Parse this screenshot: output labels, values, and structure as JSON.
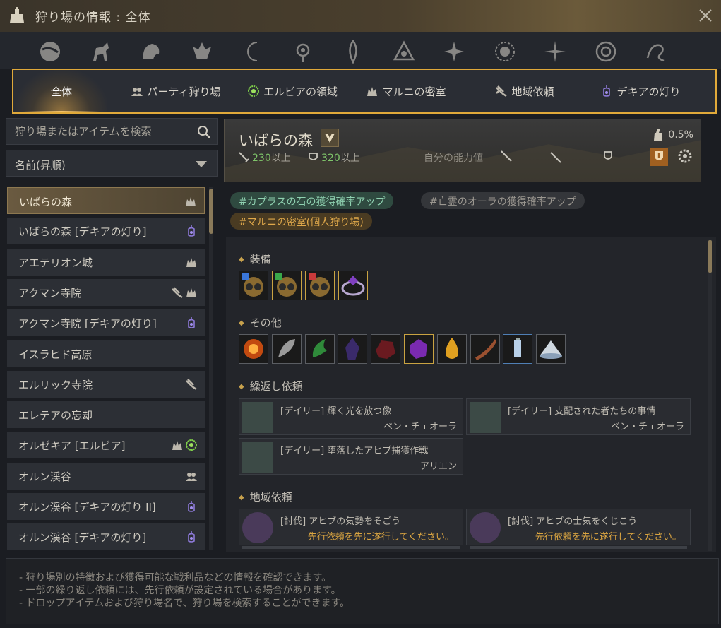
{
  "window": {
    "title": "狩り場の情報 : 全体"
  },
  "category_icons": [
    "planet-icon",
    "horse-icon",
    "beast-head-icon",
    "eagle-crest-icon",
    "crescent-moon-icon",
    "eye-crest-icon",
    "flame-crest-icon",
    "triangle-ring-icon",
    "star-burst-icon",
    "sun-icon",
    "compass-star-icon",
    "round-crest-icon",
    "scroll-flourish-icon"
  ],
  "tabs": [
    {
      "label": "全体",
      "icon": ""
    },
    {
      "label": "パーティ狩り場",
      "icon": "party-icon"
    },
    {
      "label": "エルビアの領域",
      "icon": "elvia-icon"
    },
    {
      "label": "マルニの密室",
      "icon": "marni-icon"
    },
    {
      "label": "地域依頼",
      "icon": "quest-icon"
    },
    {
      "label": "デキアの灯り",
      "icon": "lamp-icon"
    }
  ],
  "search": {
    "placeholder": "狩り場またはアイテムを検索"
  },
  "sort": {
    "label": "名前(昇順)"
  },
  "list": [
    {
      "label": "いばらの森",
      "icons": [
        "marni"
      ]
    },
    {
      "label": "いばらの森 [デキアの灯り]",
      "icons": [
        "lamp"
      ]
    },
    {
      "label": "アエテリオン城",
      "icons": [
        "marni"
      ]
    },
    {
      "label": "アクマン寺院",
      "icons": [
        "quest",
        "marni"
      ]
    },
    {
      "label": "アクマン寺院 [デキアの灯り]",
      "icons": [
        "lamp"
      ]
    },
    {
      "label": "イスラヒド高原",
      "icons": []
    },
    {
      "label": "エルリック寺院",
      "icons": [
        "quest"
      ]
    },
    {
      "label": "エレテアの忘却",
      "icons": []
    },
    {
      "label": "オルゼキア [エルビア]",
      "icons": [
        "marni",
        "elvia"
      ]
    },
    {
      "label": "オルン渓谷",
      "icons": [
        "party"
      ]
    },
    {
      "label": "オルン渓谷 [デキアの灯り II]",
      "icons": [
        "lamp"
      ]
    },
    {
      "label": "オルン渓谷 [デキアの灯り]",
      "icons": [
        "lamp"
      ]
    }
  ],
  "detail": {
    "name": "いばらの森",
    "ap_value": "230",
    "ap_suffix": "以上",
    "dp_value": "320",
    "dp_suffix": "以上",
    "my_stats_label": "自分の能力値",
    "drop_rate": "0.5%",
    "tags": [
      {
        "text": "#カプラスの石の獲得確率アップ",
        "color": "#8fd1b0",
        "bg": "#2f4a40"
      },
      {
        "text": "#亡霊のオーラの獲得確率アップ",
        "color": "#9b9790",
        "bg": "#34363a"
      },
      {
        "text": "#マルニの密室(個人狩り場)",
        "color": "#e0a94b",
        "bg": "#4a3b22"
      }
    ],
    "sections": {
      "equipment": "装備",
      "others": "その他",
      "repeat_quests": "繰返し依頼",
      "region_quests": "地域依頼"
    },
    "equipment_items": [
      "blue-gem-earring-icon",
      "green-gem-earring-icon",
      "red-gem-earring-icon",
      "purple-ring-icon"
    ],
    "other_items": [
      "fire-burst-icon",
      "silver-feather-icon",
      "green-claw-icon",
      "dark-crystal-icon",
      "red-ore-icon",
      "purple-stone-icon",
      "golden-drop-icon",
      "bronze-horn-icon",
      "elixir-vial-icon",
      "tent-icon"
    ],
    "repeat_quests": [
      {
        "title": "[デイリー] 輝く光を放つ像",
        "npc": "ベン・チェオーラ"
      },
      {
        "title": "[デイリー] 支配された者たちの事情",
        "npc": "ベン・チェオーラ"
      },
      {
        "title": "[デイリー] 堕落したアヒブ捕獲作戦",
        "npc": "アリエン"
      }
    ],
    "region_quests": [
      {
        "title": "[討伐] アヒブの気勢をそごう",
        "warning": "先行依頼を先に遂行してください。"
      },
      {
        "title": "[討伐] アヒブの士気をくじこう",
        "warning": "先行依頼を先に遂行してください。"
      }
    ]
  },
  "footer": [
    "- 狩り場別の特徴および獲得可能な戦利品などの情報を確認できます。",
    "- 一部の繰り返し依頼には、先行依頼が設定されている場合があります。",
    "- ドロップアイテムおよび狩り場名で、狩り場を検索することができます。"
  ],
  "colors": {
    "accent": "#e0a93a",
    "positive": "#7fc56a",
    "warning": "#d9a441"
  }
}
